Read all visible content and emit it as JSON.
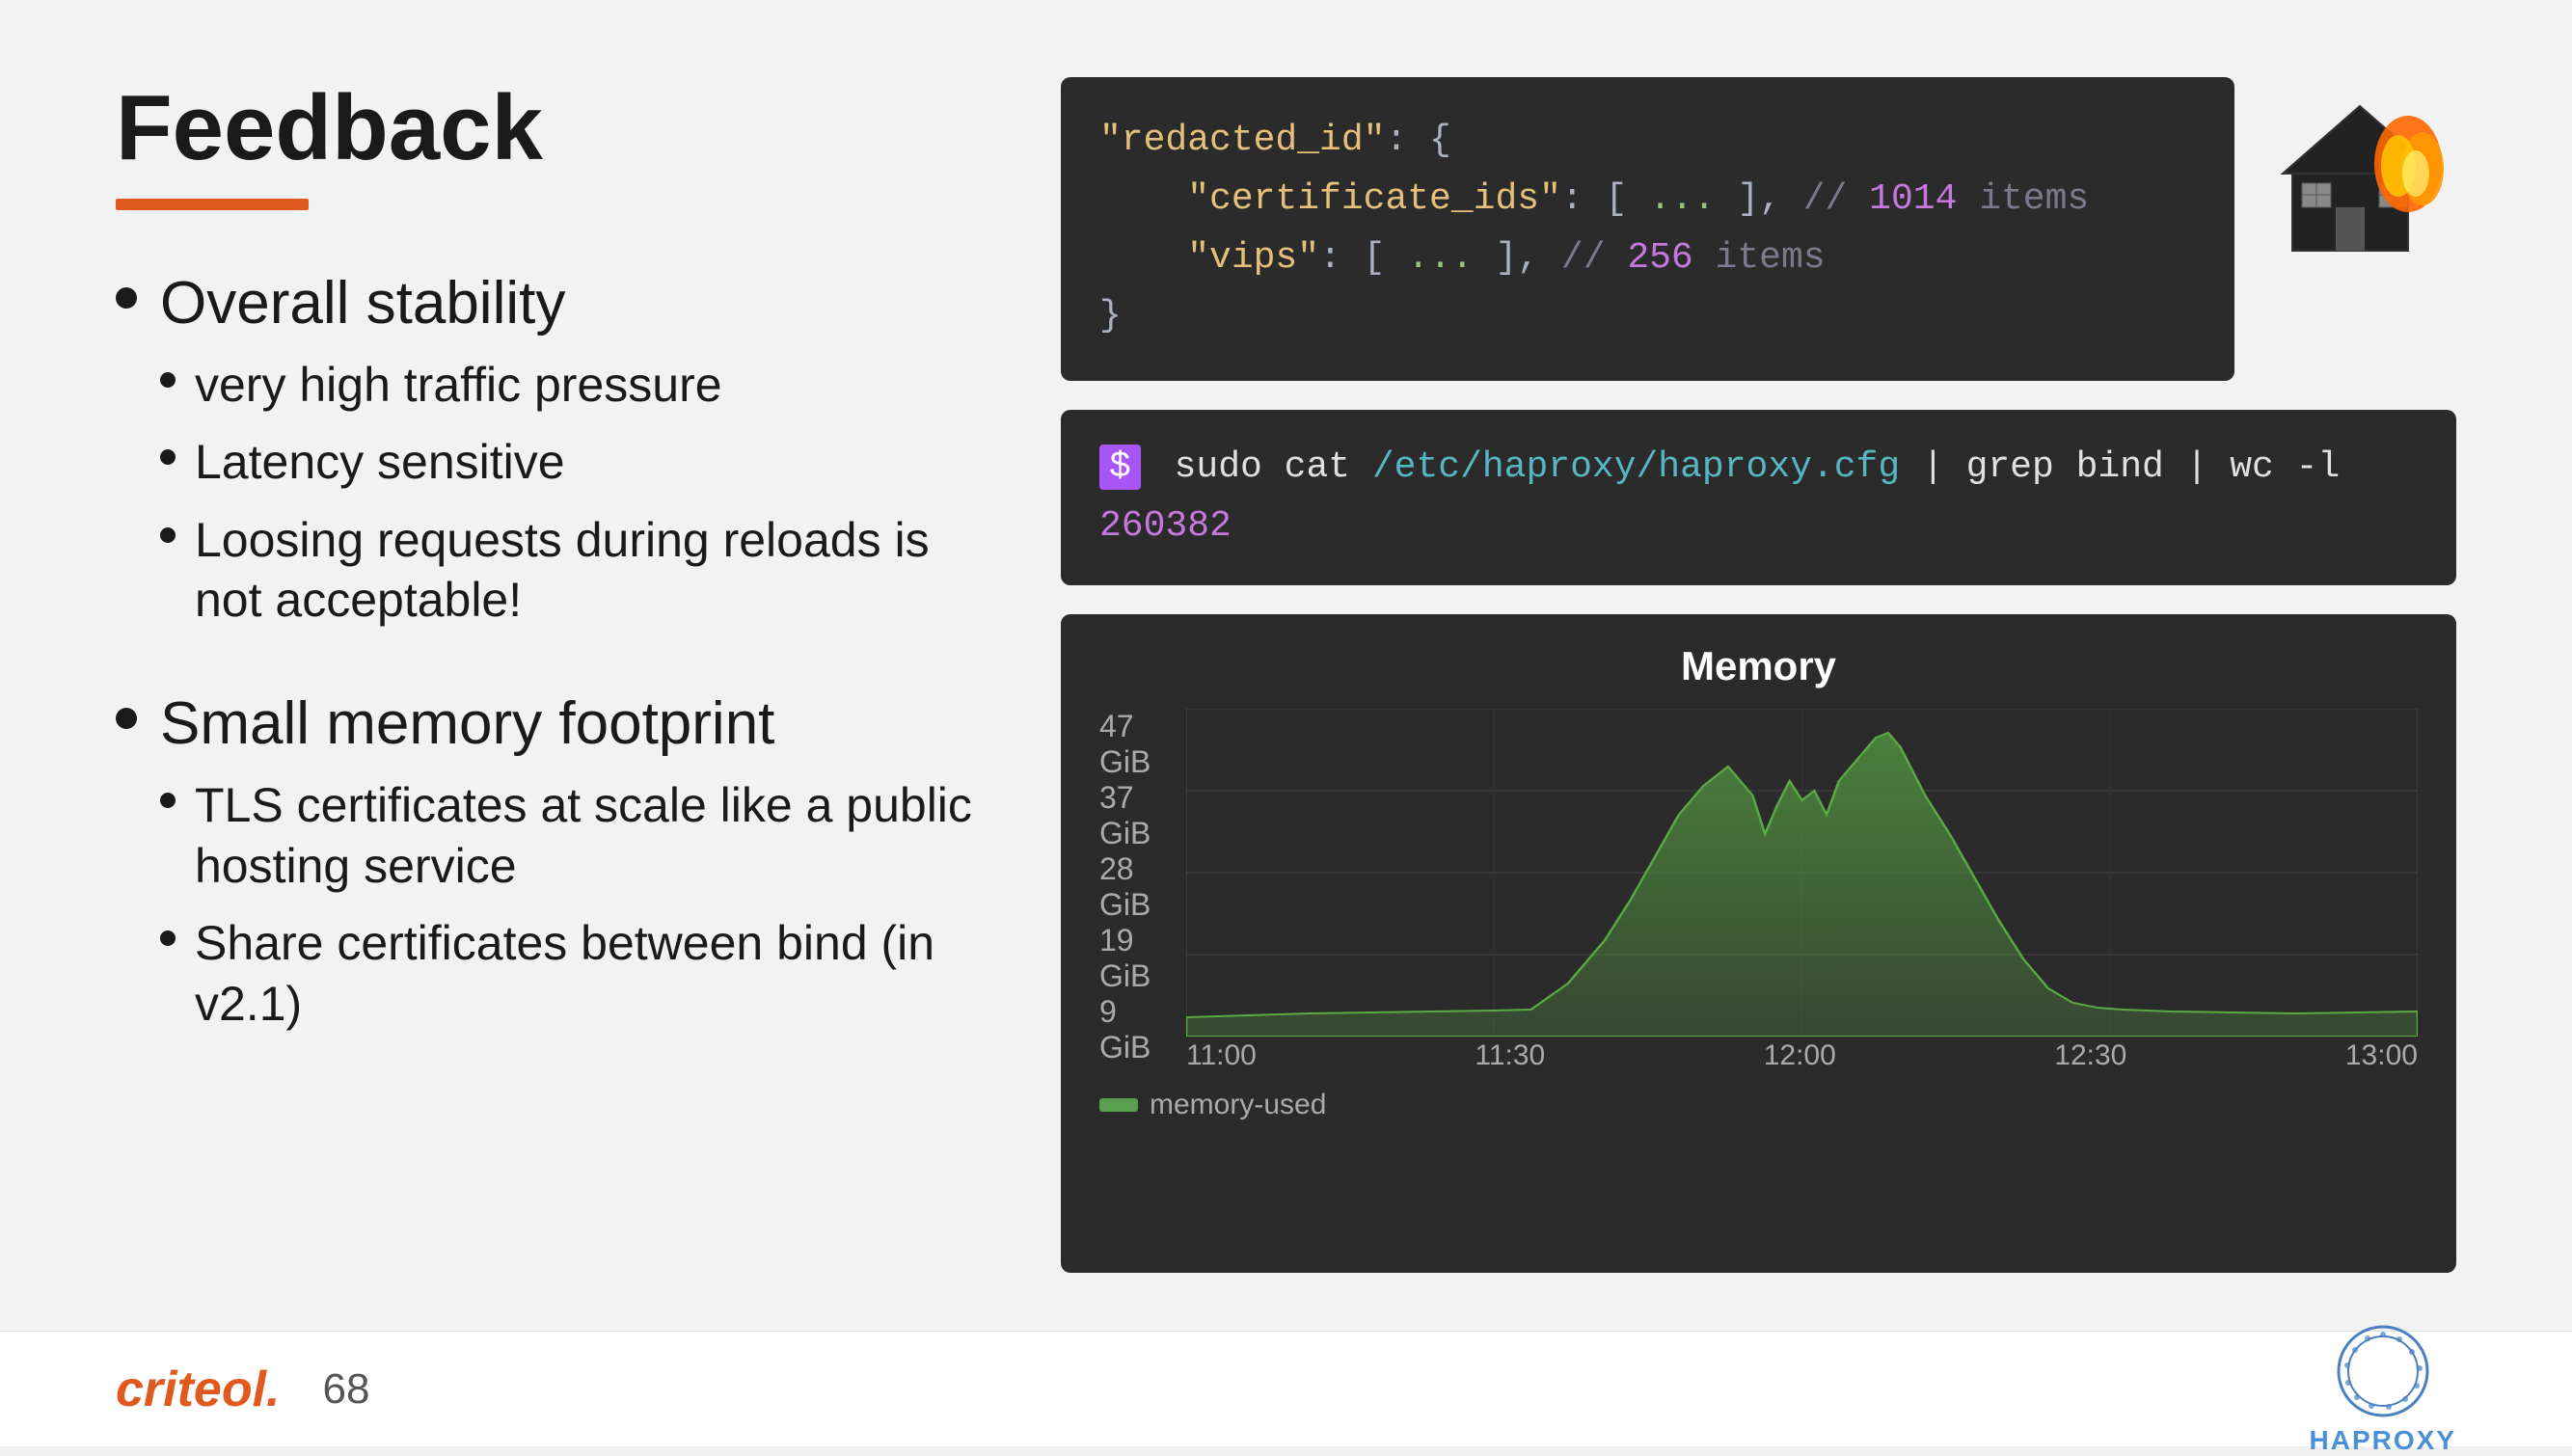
{
  "slide": {
    "title": "Feedback",
    "underline_color": "#e05a20",
    "bullets": [
      {
        "id": "overall-stability",
        "text": "Overall stability",
        "sub": [
          {
            "id": "traffic",
            "text": "very high traffic pressure"
          },
          {
            "id": "latency",
            "text": "Latency sensitive"
          },
          {
            "id": "loosing",
            "text": "Loosing requests during reloads is not acceptable!"
          }
        ]
      },
      {
        "id": "small-memory",
        "text": "Small memory footprint",
        "sub": [
          {
            "id": "tls",
            "text": "TLS certificates at scale like a public hosting service"
          },
          {
            "id": "share",
            "text": "Share certificates between bind (in v2.1)"
          }
        ]
      }
    ],
    "code_block_1": {
      "lines": [
        {
          "parts": [
            {
              "text": "\"redacted_id\"",
              "class": "code-yellow"
            },
            {
              "text": ": {",
              "class": "code-white"
            }
          ]
        },
        {
          "parts": [
            {
              "text": "    \"certificate_ids\"",
              "class": "code-yellow"
            },
            {
              "text": ": [ ",
              "class": "code-white"
            },
            {
              "text": "...",
              "class": "code-green-text"
            },
            {
              "text": " ], ",
              "class": "code-white"
            },
            {
              "text": "// ",
              "class": "code-comment"
            },
            {
              "text": "1014",
              "class": "code-purple"
            },
            {
              "text": " items",
              "class": "code-comment"
            }
          ]
        },
        {
          "parts": [
            {
              "text": "    \"vips\"",
              "class": "code-yellow"
            },
            {
              "text": ": [ ",
              "class": "code-white"
            },
            {
              "text": "...",
              "class": "code-green-text"
            },
            {
              "text": " ], ",
              "class": "code-white"
            },
            {
              "text": "// ",
              "class": "code-comment"
            },
            {
              "text": "256",
              "class": "code-purple"
            },
            {
              "text": " items",
              "class": "code-comment"
            }
          ]
        },
        {
          "parts": [
            {
              "text": "}",
              "class": "code-white"
            }
          ]
        }
      ]
    },
    "code_block_2": {
      "prompt": "$",
      "command": "sudo cat /etc/haproxy/haproxy.cfg | grep bind | wc -l",
      "result": "260382",
      "command_parts": [
        {
          "text": "sudo cat ",
          "class": "cmd-white"
        },
        {
          "text": "/etc/haproxy/haproxy.cfg",
          "class": "cmd-white"
        },
        {
          "text": " | grep ",
          "class": "cmd-white"
        },
        {
          "text": "bind",
          "class": "cmd-white"
        },
        {
          "text": " | wc -l",
          "class": "cmd-white"
        }
      ]
    },
    "chart": {
      "title": "Memory",
      "y_labels": [
        "47 GiB",
        "37 GiB",
        "28 GiB",
        "19 GiB",
        "9 GiB"
      ],
      "x_labels": [
        "11:00",
        "11:30",
        "12:00",
        "12:30",
        "13:00"
      ],
      "legend_label": "memory-used"
    }
  },
  "footer": {
    "logo_text": "criteo",
    "logo_dot": ".",
    "page_number": "68",
    "haproxy_label": "HAPROXY"
  }
}
